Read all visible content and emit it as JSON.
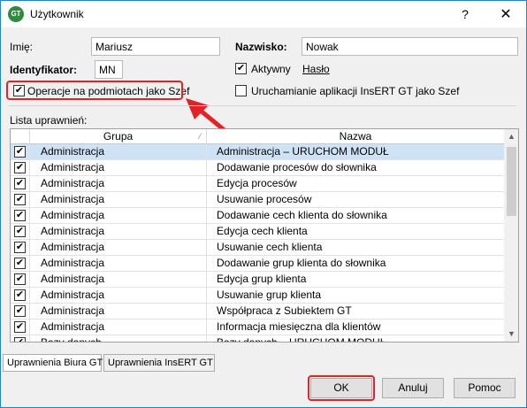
{
  "window": {
    "title": "Użytkownik",
    "app_icon_text": "GT",
    "help_glyph": "?",
    "close_glyph": "✕"
  },
  "form": {
    "imie_label": "Imię:",
    "imie_value": "Mariusz",
    "nazwisko_label": "Nazwisko:",
    "nazwisko_value": "Nowak",
    "identyfikator_label": "Identyfikator:",
    "identyfikator_value": "MN",
    "aktywny_label": "Aktywny",
    "aktywny_checked": true,
    "haslo_link": "Hasło",
    "operacje_label": "Operacje na podmiotach jako Szef",
    "operacje_checked": true,
    "uruchamianie_label": "Uruchamianie aplikacji InsERT GT jako Szef",
    "uruchamianie_checked": false
  },
  "permissions": {
    "list_label": "Lista uprawnień:",
    "columns": [
      "Grupa",
      "Nazwa"
    ],
    "sort_indicator": "⁄",
    "rows": [
      {
        "checked": true,
        "grupa": "Administracja",
        "nazwa": "Administracja – URUCHOM MODUŁ",
        "selected": true
      },
      {
        "checked": true,
        "grupa": "Administracja",
        "nazwa": "Dodawanie procesów do słownika"
      },
      {
        "checked": true,
        "grupa": "Administracja",
        "nazwa": "Edycja procesów"
      },
      {
        "checked": true,
        "grupa": "Administracja",
        "nazwa": "Usuwanie procesów"
      },
      {
        "checked": true,
        "grupa": "Administracja",
        "nazwa": "Dodawanie cech klienta do słownika"
      },
      {
        "checked": true,
        "grupa": "Administracja",
        "nazwa": "Edycja cech klienta"
      },
      {
        "checked": true,
        "grupa": "Administracja",
        "nazwa": "Usuwanie cech klienta"
      },
      {
        "checked": true,
        "grupa": "Administracja",
        "nazwa": "Dodawanie grup klienta do słownika"
      },
      {
        "checked": true,
        "grupa": "Administracja",
        "nazwa": "Edycja grup klienta"
      },
      {
        "checked": true,
        "grupa": "Administracja",
        "nazwa": "Usuwanie grup klienta"
      },
      {
        "checked": true,
        "grupa": "Administracja",
        "nazwa": "Współpraca z Subiektem GT"
      },
      {
        "checked": true,
        "grupa": "Administracja",
        "nazwa": "Informacja miesięczna dla klientów"
      },
      {
        "checked": true,
        "grupa": "Bazy danych",
        "nazwa": "Bazy danych – URUCHOM MODUŁ"
      }
    ],
    "scroll_up_glyph": "▲",
    "scroll_down_glyph": "▼"
  },
  "tabs": [
    "Uprawnienia Biura GT",
    "Uprawnienia InsERT GT"
  ],
  "buttons": {
    "ok": "OK",
    "cancel": "Anuluj",
    "help": "Pomoc"
  },
  "colors": {
    "highlight": "#e32226",
    "selected_row": "#cfe3f7",
    "title_border": "#1883d7"
  }
}
